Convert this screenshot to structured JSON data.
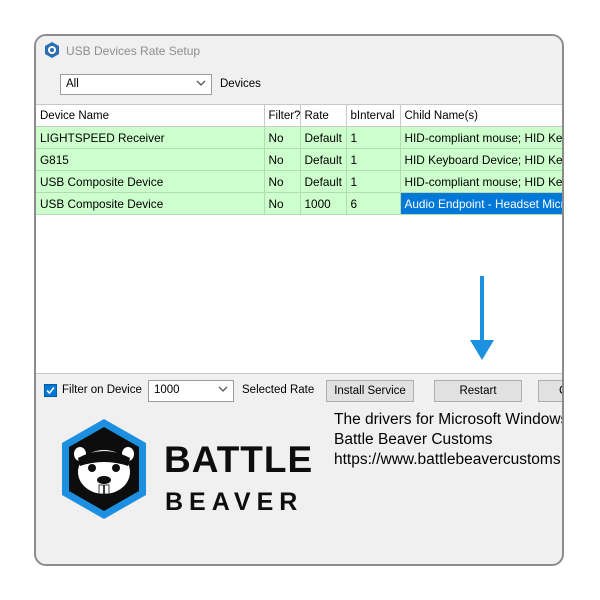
{
  "window": {
    "title": "USB Devices Rate Setup"
  },
  "filter": {
    "selected": "All",
    "label": "Devices"
  },
  "table": {
    "headers": [
      "Device Name",
      "Filter?",
      "Rate",
      "bInterval",
      "Child Name(s)"
    ],
    "rows": [
      [
        "LIGHTSPEED Receiver",
        "No",
        "Default",
        "1",
        "HID-compliant mouse; HID Keyboard"
      ],
      [
        "G815",
        "No",
        "Default",
        "1",
        "HID Keyboard Device; HID Keyboard"
      ],
      [
        "USB Composite Device",
        "No",
        "Default",
        "1",
        "HID-compliant mouse; HID Keyboard"
      ],
      [
        "USB Composite Device",
        "No",
        "1000",
        "6",
        "Audio Endpoint - Headset Microphone"
      ]
    ],
    "selected_row": 3
  },
  "controls": {
    "filter_on_device_label": "Filter on Device",
    "filter_on_device_checked": true,
    "rate_value": "1000",
    "selected_rate_label": "Selected Rate",
    "install_service": "Install Service",
    "restart": "Restart",
    "close_partial": "C"
  },
  "info": {
    "line1": "The drivers for Microsoft Windows",
    "line2": "Battle Beaver Customs",
    "line3": "https://www.battlebeavercustoms"
  },
  "logo": {
    "line1": "BATTLE",
    "line2": "BEAVER"
  },
  "colors": {
    "grid_row": "#ccffcc",
    "selection": "#0078d7",
    "arrow": "#1e90e0",
    "logo_blue": "#1d8fe1"
  }
}
